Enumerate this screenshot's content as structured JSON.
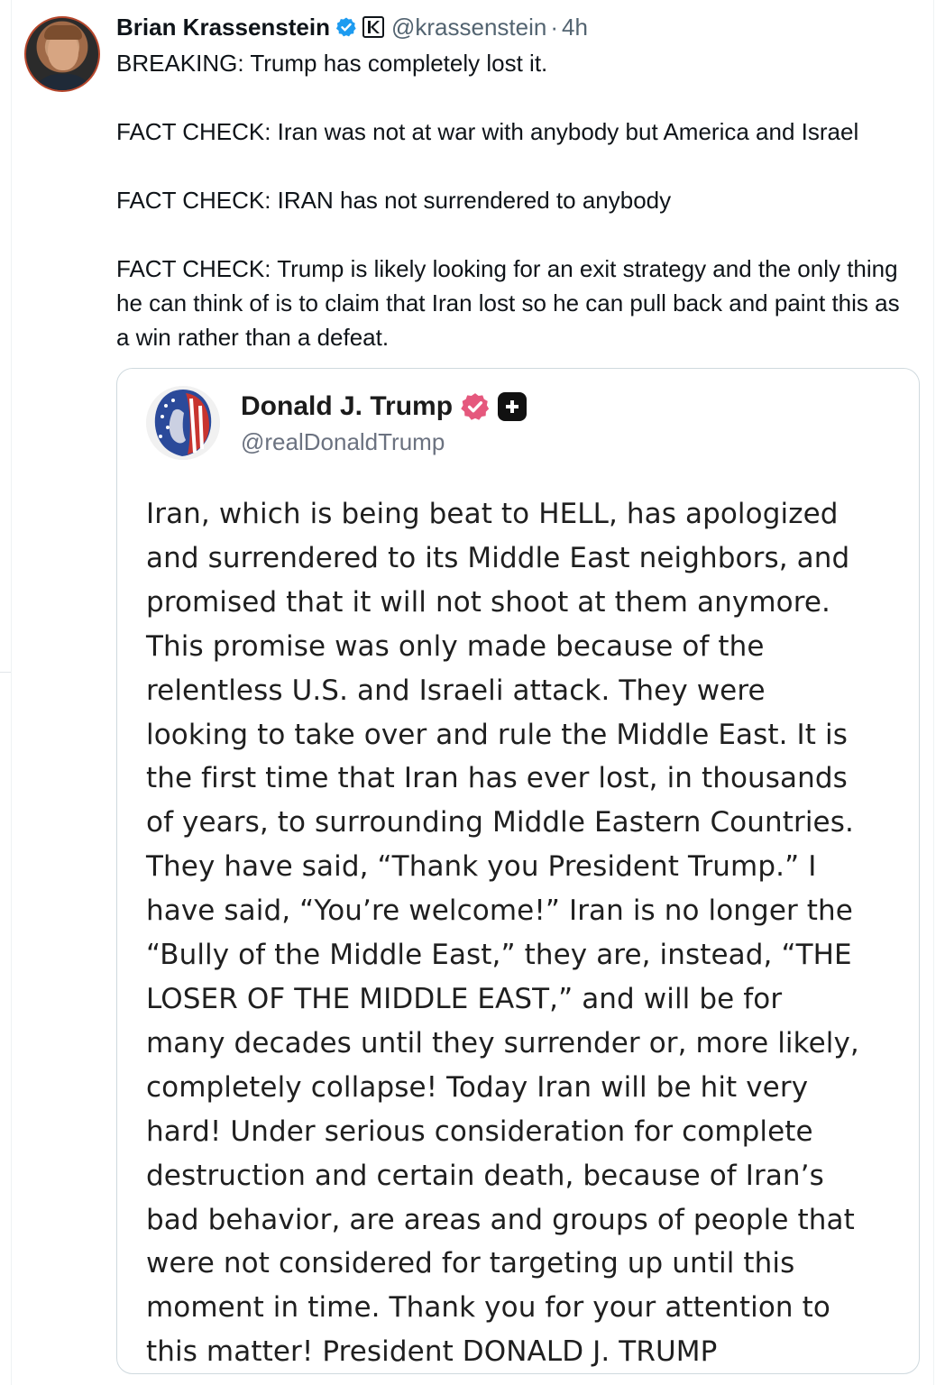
{
  "tweet": {
    "author_name": "Brian Krassenstein",
    "handle": "@krassenstein",
    "separator": "·",
    "time": "4h",
    "paragraphs": [
      "BREAKING:  Trump has completely lost it.",
      "FACT CHECK: Iran was not at war with anybody but America and Israel",
      "FACT CHECK: IRAN has not surrendered to anybody",
      "FACT CHECK: Trump is likely looking for an exit strategy and the only thing he can think of is to claim that Iran lost so he can pull back and paint this as a win rather than a defeat."
    ]
  },
  "quote": {
    "name": "Donald J. Trump",
    "handle": "@realDonaldTrump",
    "body_lines": [
      "Iran, which is being beat to HELL, has apologized",
      "and surrendered to its Middle East neighbors, and",
      "promised that it will not shoot at them anymore.",
      "This promise was only made because of the",
      "relentless U.S. and Israeli attack. They were",
      "looking to take over and rule the Middle East. It is",
      "the first time that Iran has ever lost, in thousands",
      "of years, to surrounding Middle Eastern Countries.",
      "They have said, “Thank you President Trump.” I",
      "have said, “You’re welcome!” Iran is no longer the",
      "“Bully of the Middle East,” they are, instead, “THE",
      "LOSER OF THE MIDDLE EAST,” and will be for",
      "many decades until they surrender or, more likely,",
      "completely collapse! Today Iran will be hit very",
      "hard! Under serious consideration for complete",
      "destruction and certain death, because of Iran’s",
      "bad behavior, are areas and groups of people that",
      "were not considered for targeting up until this",
      "moment in time. Thank you for your attention to",
      "this matter! President DONALD J. TRUMP"
    ]
  },
  "colors": {
    "verified_blue": "#1d9bf0",
    "truth_badge": "#e5587d",
    "secondary_text": "#536471"
  },
  "icons": {
    "verified": "verified-badge-icon",
    "affiliate": "affiliate-k-icon",
    "truth_verified": "verified-rosette-icon",
    "plus": "plus-badge-icon"
  }
}
